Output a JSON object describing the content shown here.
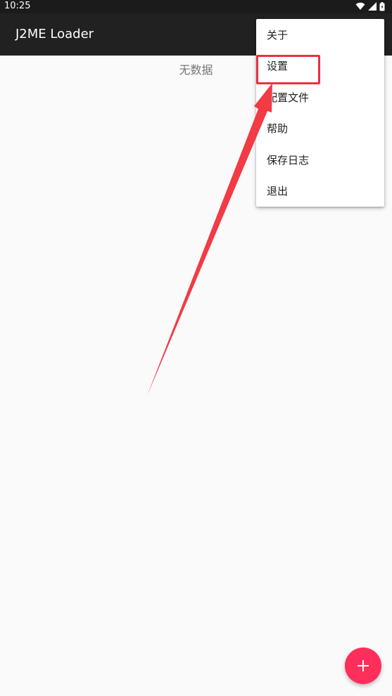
{
  "status_bar": {
    "time": "10:25",
    "icons": [
      "wifi-icon",
      "signal-icon",
      "battery-icon"
    ]
  },
  "app_bar": {
    "title": "J2ME Loader"
  },
  "main": {
    "empty_text": "无数据"
  },
  "overflow_menu": {
    "items": [
      {
        "label": "关于"
      },
      {
        "label": "设置"
      },
      {
        "label": "配置文件"
      },
      {
        "label": "帮助"
      },
      {
        "label": "保存日志"
      },
      {
        "label": "退出"
      }
    ]
  },
  "fab": {
    "icon": "add-icon"
  },
  "colors": {
    "accent": "#ff2e5b",
    "app_bar": "#212121",
    "annotation": "#e8323f"
  }
}
